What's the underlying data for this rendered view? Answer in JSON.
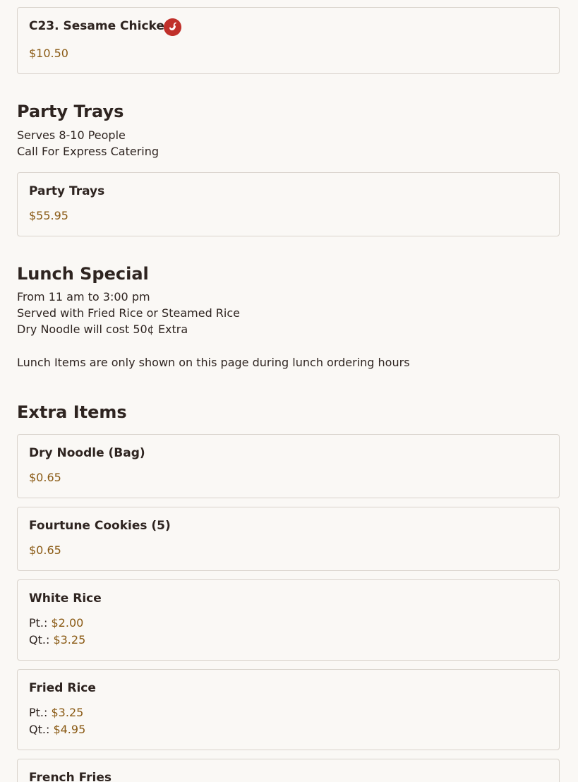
{
  "top_item": {
    "name": "C23. Sesame Chicken",
    "icon": "spicy-pepper-icon",
    "price": "$10.50"
  },
  "party_trays": {
    "title": "Party Trays",
    "description": [
      "Serves 8-10 People",
      "Call For Express Catering"
    ],
    "items": [
      {
        "name": "Party Trays",
        "price": "$55.95"
      }
    ]
  },
  "lunch_special": {
    "title": "Lunch Special",
    "description": [
      "From 11 am to 3:00 pm",
      "Served with Fried Rice or Steamed Rice",
      "Dry Noodle will cost 50¢ Extra"
    ],
    "note": "Lunch Items are only shown on this page during lunch ordering hours"
  },
  "extra_items": {
    "title": "Extra Items",
    "items": [
      {
        "name": "Dry Noodle (Bag)",
        "price": "$0.65"
      },
      {
        "name": "Fourtune Cookies (5)",
        "price": "$0.65"
      },
      {
        "name": "White Rice",
        "prices": [
          {
            "label": "Pt.:",
            "price": "$2.00"
          },
          {
            "label": "Qt.:",
            "price": "$3.25"
          }
        ]
      },
      {
        "name": "Fried Rice",
        "prices": [
          {
            "label": "Pt.:",
            "price": "$3.25"
          },
          {
            "label": "Qt.:",
            "price": "$4.95"
          }
        ]
      },
      {
        "name": "French Fries"
      }
    ]
  },
  "colors": {
    "price": "#8a5a14",
    "text": "#2e2420",
    "border": "#d9d3cc",
    "spicy_icon": "#c0302a",
    "background": "#faf8f5"
  }
}
